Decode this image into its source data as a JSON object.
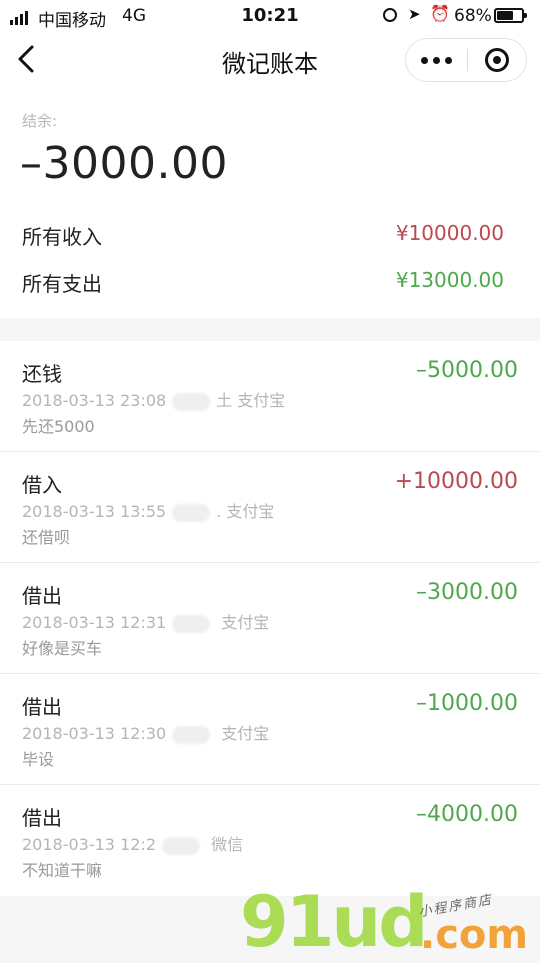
{
  "status_bar": {
    "carrier": "中国移动",
    "network": "4G",
    "time": "10:21",
    "battery": "68%",
    "battery_level": 0.68,
    "icons": [
      "signal-icon",
      "orientation-lock-icon",
      "location-icon",
      "alarm-icon",
      "battery-icon"
    ]
  },
  "nav": {
    "title": "微记账本",
    "back_icon": "chevron-left-icon",
    "more_icon": "more-dots-icon",
    "close_icon": "target-close-icon"
  },
  "summary": {
    "balance_label": "结余:",
    "balance_value": "–3000.00",
    "income_label": "所有收入",
    "income_value": "¥10000.00",
    "expense_label": "所有支出",
    "expense_value": "¥13000.00"
  },
  "colors": {
    "income": "#b94a4f",
    "expense": "#4ea84b"
  },
  "transactions": [
    {
      "type": "还钱",
      "amount": "–5000.00",
      "datetime": "2018-03-13 23:08",
      "account_suffix": "土",
      "channel": "支付宝",
      "note": "先还5000",
      "direction": "out"
    },
    {
      "type": "借入",
      "amount": "+10000.00",
      "datetime": "2018-03-13 13:55",
      "account_suffix": ".",
      "channel": "支付宝",
      "note": "还借呗",
      "direction": "in"
    },
    {
      "type": "借出",
      "amount": "–3000.00",
      "datetime": "2018-03-13 12:31",
      "account_suffix": "",
      "channel": "支付宝",
      "note": "好像是买车",
      "direction": "out"
    },
    {
      "type": "借出",
      "amount": "–1000.00",
      "datetime": "2018-03-13 12:30",
      "account_suffix": "",
      "channel": "支付宝",
      "note": "毕设",
      "direction": "out"
    },
    {
      "type": "借出",
      "amount": "–4000.00",
      "datetime": "2018-03-13 12:2",
      "account_suffix": "",
      "channel": "微信",
      "note": "不知道干嘛",
      "direction": "out"
    }
  ],
  "watermark": {
    "big": "91ud",
    "com": ".com",
    "tag": "小程序商店"
  }
}
